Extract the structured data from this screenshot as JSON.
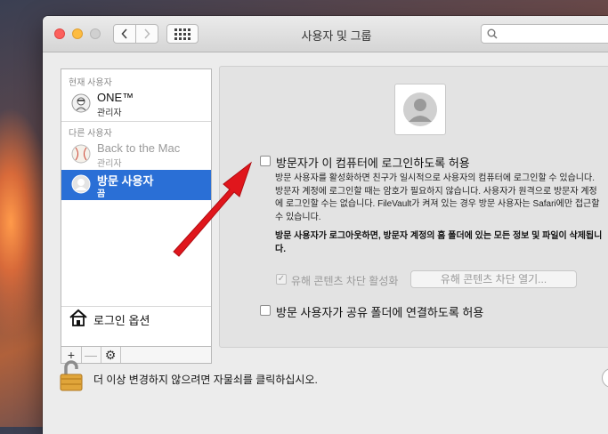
{
  "window": {
    "title": "사용자 및 그룹"
  },
  "search": {
    "placeholder": ""
  },
  "sidebar": {
    "current_header": "현재 사용자",
    "current_user": {
      "name": "ONE™",
      "role": "관리자"
    },
    "other_header": "다른 사용자",
    "other_users": [
      {
        "name": "Back to the Mac",
        "role": "관리자"
      },
      {
        "name": "방문 사용자",
        "role": "끔"
      }
    ],
    "login_options": "로그인 옵션",
    "tools": {
      "add": "+",
      "remove": "—",
      "gear": "⚙"
    }
  },
  "main": {
    "allow_login_label": "방문자가 이 컴퓨터에 로그인하도록 허용",
    "description": "방문 사용자를 활성화하면 친구가 일시적으로 사용자의 컴퓨터에 로그인할 수 있습니다. 방문자 계정에 로그인할 때는 암호가 필요하지 않습니다. 사용자가 원격으로 방문자 계정에 로그인할 수는 없습니다. FileVault가 켜져 있는 경우 방문 사용자는 Safari에만 접근할 수 있습니다.",
    "warning": "방문 사용자가 로그아웃하면, 방문자 계정의 홈 폴더에 있는 모든 정보 및 파일이 삭제됩니다.",
    "parental_controls_label": "유해 콘텐츠 차단 활성화",
    "parental_controls_button": "유해 콘텐츠 차단 열기...",
    "shared_folders_label": "방문 사용자가 공유 폴더에 연결하도록 허용"
  },
  "footer": {
    "lock_text": "더 이상 변경하지 않으려면 자물쇠를 클릭하십시오."
  },
  "colors": {
    "selection": "#2a6fd6",
    "arrow": "#e0161c"
  }
}
